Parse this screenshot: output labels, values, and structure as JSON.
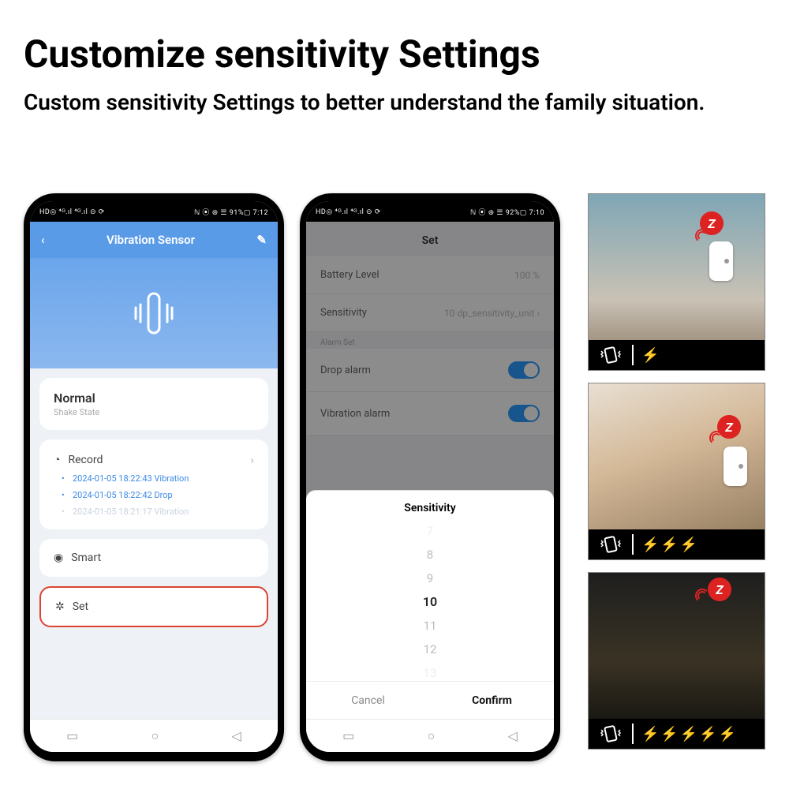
{
  "headline": "Customize sensitivity Settings",
  "subhead": "Custom sensitivity Settings to better understand the family situation.",
  "statusbar": {
    "left": "HD◎ ⁴ᴳ.ıl ⁴ᴳ.ıl ⊝ ⟳",
    "right1": "ℕ ⦿ ⊛ ☰ 91%▢ 7:12",
    "right2": "ℕ ⦿ ⊛ ☰ 92%▢ 7:10"
  },
  "phone1": {
    "header_title": "Vibration Sensor",
    "state_big": "Normal",
    "state_sub": "Shake State",
    "record_label": "Record",
    "records": [
      "2024-01-05 18:22:43 Vibration",
      "2024-01-05 18:22:42 Drop",
      "2024-01-05 18:21:17 Vibration"
    ],
    "smart_label": "Smart",
    "set_label": "Set"
  },
  "phone2": {
    "set_title": "Set",
    "rows": {
      "battery_label": "Battery Level",
      "battery_value": "100 %",
      "sensitivity_label": "Sensitivity",
      "sensitivity_value": "10 dp_sensitivity_unit",
      "section_label": "Alarm Set",
      "drop_label": "Drop alarm",
      "vibration_label": "Vibration alarm"
    },
    "picker": {
      "title": "Sensitivity",
      "items": [
        "7",
        "8",
        "9",
        "10",
        "11",
        "12",
        "13"
      ],
      "selected_index": 3,
      "cancel": "Cancel",
      "confirm": "Confirm"
    }
  },
  "side": {
    "bolts": [
      1,
      3,
      5
    ]
  }
}
